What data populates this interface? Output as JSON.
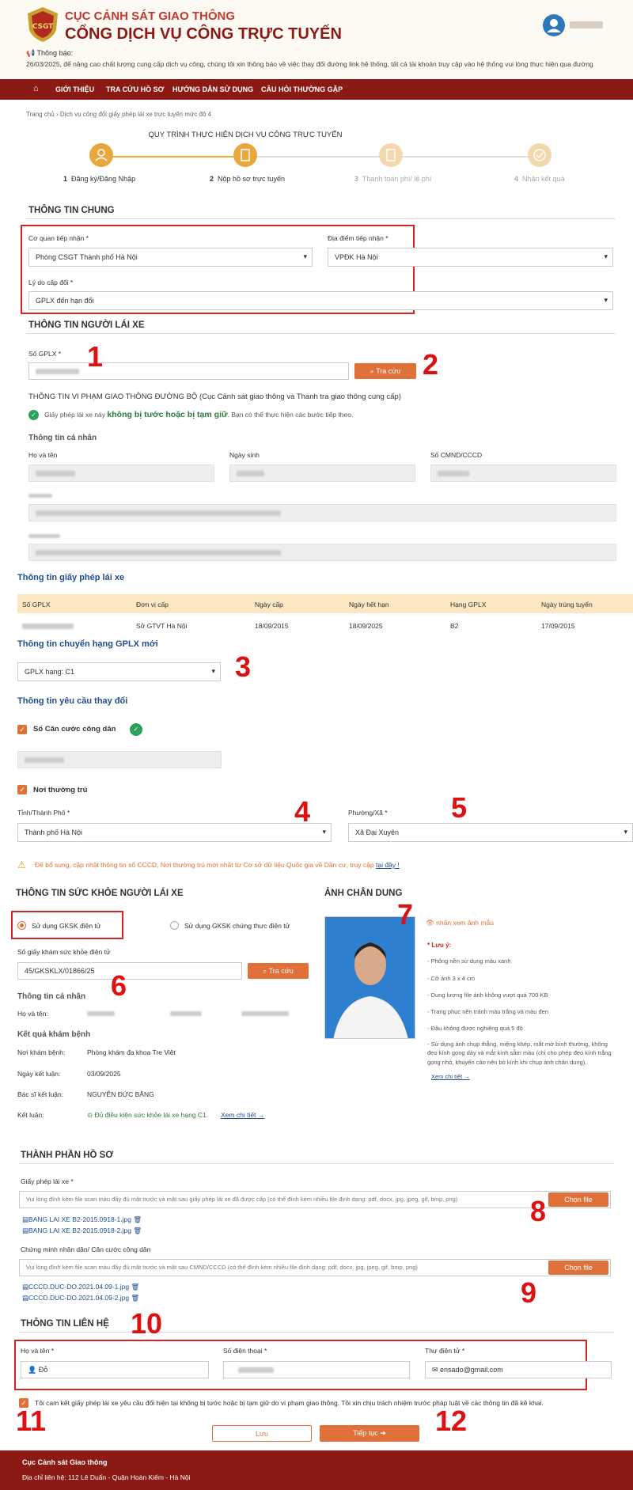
{
  "header": {
    "title_top": "CỤC CẢNH SÁT GIAO THÔNG",
    "title_main": "CỔNG DỊCH VỤ CÔNG TRỰC TUYẾN",
    "notice_label": "Thông báo:",
    "notice_text": "26/03/2025, để nâng cao chất lượng cung cấp dịch vụ công, chúng tôi xin thông báo về việc thay đổi đường link hệ thống, tất cả tài khoản truy cập vào hệ thống vui lòng thực hiện qua đường"
  },
  "nav": {
    "items": [
      "GIỚI THIỆU",
      "TRA CỨU HỒ SƠ",
      "HƯỚNG DẪN SỬ DỤNG",
      "CÂU HỎI THƯỜNG GẶP"
    ]
  },
  "breadcrumb": {
    "home": "Trang chủ",
    "current": "Dịch vụ công đổi giấy phép lái xe trực tuyến mức độ 4"
  },
  "process": {
    "title": "QUY TRÌNH THỰC HIỆN DỊCH VỤ CÔNG TRỰC TUYẾN",
    "steps": [
      {
        "num": "1",
        "label": "Đăng ký/Đăng Nhập"
      },
      {
        "num": "2",
        "label": "Nộp hồ sơ trực tuyến"
      },
      {
        "num": "3",
        "label": "Thanh toán phí/ lệ phí"
      },
      {
        "num": "4",
        "label": "Nhận kết quả"
      }
    ]
  },
  "general": {
    "title": "THÔNG TIN CHUNG",
    "agency_label": "Cơ quan tiếp nhận *",
    "agency_value": "Phòng CSGT Thành phố Hà Nội",
    "location_label": "Địa điểm tiếp nhận *",
    "location_value": "VPĐK Hà Nội",
    "reason_label": "Lý do cấp đổi *",
    "reason_value": "GPLX đến hạn đổi"
  },
  "driver": {
    "title": "THÔNG TIN NGƯỜI LÁI XE",
    "gplx_label": "Số GPLX *",
    "lookup_label": "Tra cứu",
    "violation_title": "THÔNG TIN VI PHẠM GIAO THÔNG ĐƯỜNG BỘ (Cục Cảnh sát giao thông và Thanh tra giao thông cung cấp)",
    "violation_pre": "Giấy phép lái xe này",
    "violation_bold": "không bị tước hoặc bị tạm giữ",
    "violation_post": ". Bạn có thể thực hiện các bước tiếp theo.",
    "personal_title": "Thông tin cá nhân",
    "name_label": "Họ và tên",
    "dob_label": "Ngày sinh",
    "id_label": "Số CMND/CCCD"
  },
  "license": {
    "title": "Thông tin giấy phép lái xe",
    "headers": [
      "Số GPLX",
      "Đơn vị cấp",
      "Ngày cấp",
      "Ngày hết hạn",
      "Hạng GPLX",
      "Ngày trúng tuyển"
    ],
    "row": [
      "",
      "Sở GTVT Hà Nội",
      "18/09/2015",
      "18/09/2025",
      "B2",
      "17/09/2015"
    ]
  },
  "class_change": {
    "title": "Thông tin chuyển hạng GPLX mới",
    "value": "GPLX hạng: C1"
  },
  "change_request": {
    "title": "Thông tin yêu cầu thay đổi",
    "id_check": "Số Căn cước công dân",
    "residence_check": "Nơi thường trú",
    "province_label": "Tỉnh/Thành Phố *",
    "province_value": "Thành phố Hà Nội",
    "ward_label": "Phường/Xã *",
    "ward_value": "Xã Đại Xuyên",
    "warning_text": "Để bổ sung, cập nhật thông tin số CCCD, Nơi thường trú mới nhất từ Cơ sở dữ liệu Quốc gia về Dân cư, truy cập",
    "warning_link": "tại đây !"
  },
  "health": {
    "title": "THÔNG TIN SỨC KHỎE NGƯỜI LÁI XE",
    "option_electronic": "Sử dụng GKSK điện tử",
    "option_certified": "Sử dụng GKSK chứng thực điện tử",
    "cert_label": "Số giấy khám sức khỏe điện tử",
    "cert_value": "45/GKSKLX/01866/25",
    "lookup_label": "Tra cứu",
    "personal_title": "Thông tin cá nhân",
    "name_label": "Họ và tên:",
    "result_title": "Kết quả khám bệnh",
    "place_label": "Nơi khám bệnh:",
    "place_value": "Phòng khám đa khoa Tre Việt",
    "date_label": "Ngày kết luận:",
    "date_value": "03/09/2025",
    "doctor_label": "Bác sĩ kết luận:",
    "doctor_value": "NGUYỄN ĐỨC BẰNG",
    "conclusion_label": "Kết luận:",
    "conclusion_value": "Đủ điều kiện sức khỏe lái xe hạng C1.",
    "detail_link": "Xem chi tiết →"
  },
  "portrait": {
    "title": "ẢNH CHÂN DUNG",
    "sample_link": "nhấn xem ảnh mẫu",
    "note_title": "* Lưu ý:",
    "notes": [
      "- Phông nền sử dụng màu xanh",
      "- Cỡ ảnh 3 x 4 cm",
      "- Dung lượng file ảnh không vượt quá 700 KB",
      "- Trang phục nên tránh màu trắng và màu đen",
      "- Đầu không được nghiêng quá 5 độ",
      "- Sử dụng ảnh chụp thẳng, miệng khép, mắt mở bình thường, không đeo kính gọng dày và mắt kính sẫm màu (chỉ cho phép đeo kính trắng gọng nhỏ, khuyến cáo nên bỏ kính khi chụp ảnh chân dung)."
    ],
    "more_link": "Xem chi tiết →"
  },
  "docs": {
    "title": "THÀNH PHẦN HỒ SƠ",
    "license_label": "Giấy phép lái xe *",
    "license_placeholder": "Vui lòng đính kèm file scan màu đầy đủ mặt trước và mặt sau giấy phép lái xe đã được cấp (có thể đính kèm nhiều file định dạng: pdf, docx, jpg, jpeg, gif, bmp, png)",
    "license_files": [
      "BANG LAI XE B2-2015.0918-1.jpg",
      "BANG LAI XE B2-2015.0918-2.jpg"
    ],
    "id_label": "Chứng minh nhân dân/ Căn cước công dân",
    "id_placeholder": "Vui lòng đính kèm file scan màu đầy đủ mặt trước và mặt sau CMND/CCCD (có thể đính kèm nhiều file định dạng: pdf, docx, jpg, jpeg, gif, bmp, png)",
    "id_files": [
      "CCCD.DUC-DO.2021.04.09-1.jpg",
      "CCCD.DUC-DO.2021.04.09-2.jpg"
    ],
    "choose_file": "Chọn file"
  },
  "contact": {
    "title": "THÔNG TIN LIÊN HỆ",
    "name_label": "Họ và tên *",
    "name_value": "Đỗ",
    "phone_label": "Số điện thoại *",
    "email_label": "Thư điện tử *",
    "email_value": "ensado@gmail.com"
  },
  "commit": {
    "text": "Tôi cam kết giấy phép lái xe yêu cầu đổi hiện tại không bị tước hoặc bị tạm giữ do vi phạm giao thông. Tôi xin chịu trách nhiệm trước pháp luật về các thông tin đã kê khai."
  },
  "actions": {
    "save": "Lưu",
    "next": "Tiếp tục ➔"
  },
  "annotations": [
    "1",
    "2",
    "3",
    "4",
    "5",
    "6",
    "7",
    "8",
    "9",
    "10",
    "11",
    "12"
  ],
  "footer": {
    "org": "Cục Cảnh sát Giao thông",
    "address": "Địa chỉ liên hệ: 112 Lê Duẩn - Quận Hoàn Kiếm - Hà Nội"
  },
  "colors": {
    "brand": "#8b1a14",
    "accent": "#e0703a",
    "annotation": "#d62323",
    "success": "#29a35a"
  }
}
